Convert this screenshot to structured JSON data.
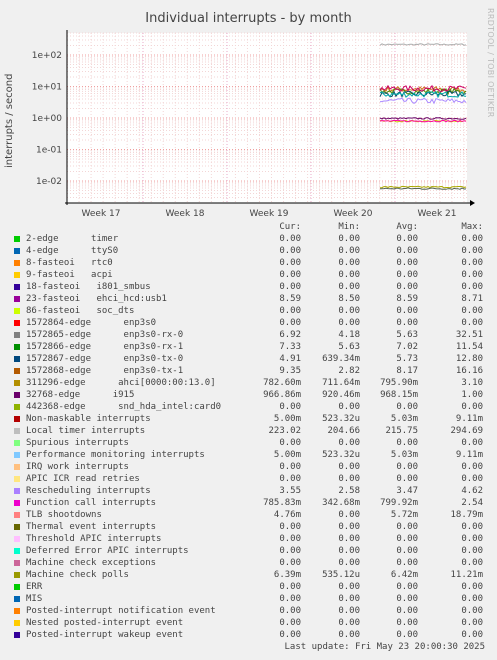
{
  "title": "Individual interrupts - by month",
  "side_text": "RRDTOOL / TOBI OETIKER",
  "chart_data": {
    "type": "line",
    "title": "Individual interrupts - by month",
    "ylabel": "interrupts / second",
    "yscale": "log",
    "ylim": [
      0.002,
      500
    ],
    "yticks": [
      "1e+02",
      "1e+01",
      "1e+00",
      "1e-01",
      "1e-02"
    ],
    "ytick_values": [
      100,
      10,
      1,
      0.1,
      0.01
    ],
    "xticks": [
      "Week 17",
      "Week 18",
      "Week 19",
      "Week 20",
      "Week 21"
    ],
    "grid": true,
    "series_visible_levels": [
      {
        "name": "Local timer interrupts",
        "color": "#aaaaaa",
        "value": 215.75
      },
      {
        "name": "1572868-edge enp3s0-tx-1",
        "color": "#cc7016",
        "value": 8.17
      },
      {
        "name": "1572866-edge enp3s0-rx-1",
        "color": "#4d8a00",
        "value": 7.02
      },
      {
        "name": "1572867-edge enp3s0-tx-0",
        "color": "#004d66",
        "value": 5.73
      },
      {
        "name": "1572865-edge enp3s0-rx-0",
        "color": "#00aaaa",
        "value": 5.63
      },
      {
        "name": "23-fasteoi ehci_hcd:usb1",
        "color": "#cc0066",
        "value": 8.59
      },
      {
        "name": "Rescheduling interrupts",
        "color": "#aa88ff",
        "value": 3.47
      },
      {
        "name": "311296-edge ahci[0000:00:13.0]",
        "color": "#cccc00",
        "value": 0.7959
      },
      {
        "name": "32768-edge i915",
        "color": "#660066",
        "value": 0.96815
      },
      {
        "name": "Function call interrupts",
        "color": "#ff00aa",
        "value": 0.79992
      },
      {
        "name": "Machine check polls",
        "color": "#aaaa00",
        "value": 0.00642
      },
      {
        "name": "Thermal event interrupts",
        "color": "#556655",
        "value": 0.00572
      }
    ]
  },
  "legend": {
    "headers": [
      "Cur:",
      "Min:",
      "Avg:",
      "Max:"
    ],
    "rows": [
      {
        "color": "#00cc00",
        "name": "2-edge      timer",
        "cur": "0.00",
        "min": "0.00",
        "avg": "0.00",
        "max": "0.00"
      },
      {
        "color": "#0066b3",
        "name": "4-edge      ttyS0",
        "cur": "0.00",
        "min": "0.00",
        "avg": "0.00",
        "max": "0.00"
      },
      {
        "color": "#ff8000",
        "name": "8-fasteoi   rtc0",
        "cur": "0.00",
        "min": "0.00",
        "avg": "0.00",
        "max": "0.00"
      },
      {
        "color": "#ffcc00",
        "name": "9-fasteoi   acpi",
        "cur": "0.00",
        "min": "0.00",
        "avg": "0.00",
        "max": "0.00"
      },
      {
        "color": "#330099",
        "name": "18-fasteoi   i801_smbus",
        "cur": "0.00",
        "min": "0.00",
        "avg": "0.00",
        "max": "0.00"
      },
      {
        "color": "#990099",
        "name": "23-fasteoi   ehci_hcd:usb1",
        "cur": "8.59",
        "min": "8.50",
        "avg": "8.59",
        "max": "8.71"
      },
      {
        "color": "#ccff00",
        "name": "86-fasteoi   soc_dts",
        "cur": "0.00",
        "min": "0.00",
        "avg": "0.00",
        "max": "0.00"
      },
      {
        "color": "#ff0000",
        "name": "1572864-edge      enp3s0",
        "cur": "0.00",
        "min": "0.00",
        "avg": "0.00",
        "max": "0.00"
      },
      {
        "color": "#808080",
        "name": "1572865-edge      enp3s0-rx-0",
        "cur": "6.92",
        "min": "4.18",
        "avg": "5.63",
        "max": "32.51"
      },
      {
        "color": "#008f00",
        "name": "1572866-edge      enp3s0-rx-1",
        "cur": "7.33",
        "min": "5.63",
        "avg": "7.02",
        "max": "11.54"
      },
      {
        "color": "#00487d",
        "name": "1572867-edge      enp3s0-tx-0",
        "cur": "4.91",
        "min": "639.34m",
        "avg": "5.73",
        "max": "12.80"
      },
      {
        "color": "#b35a00",
        "name": "1572868-edge      enp3s0-tx-1",
        "cur": "9.35",
        "min": "2.82",
        "avg": "8.17",
        "max": "16.16"
      },
      {
        "color": "#b38f00",
        "name": "311296-edge      ahci[0000:00:13.0]",
        "cur": "782.60m",
        "min": "711.64m",
        "avg": "795.90m",
        "max": "3.10"
      },
      {
        "color": "#6b006b",
        "name": "32768-edge      i915",
        "cur": "966.86m",
        "min": "920.46m",
        "avg": "968.15m",
        "max": "1.00"
      },
      {
        "color": "#8fb300",
        "name": "442368-edge      snd_hda_intel:card0",
        "cur": "0.00",
        "min": "0.00",
        "avg": "0.00",
        "max": "0.00"
      },
      {
        "color": "#b30000",
        "name": "Non-maskable interrupts",
        "cur": "5.00m",
        "min": "523.32u",
        "avg": "5.03m",
        "max": "9.11m"
      },
      {
        "color": "#bebebe",
        "name": "Local timer interrupts",
        "cur": "223.02",
        "min": "204.66",
        "avg": "215.75",
        "max": "294.69"
      },
      {
        "color": "#80ff80",
        "name": "Spurious interrupts",
        "cur": "0.00",
        "min": "0.00",
        "avg": "0.00",
        "max": "0.00"
      },
      {
        "color": "#80c9ff",
        "name": "Performance monitoring interrupts",
        "cur": "5.00m",
        "min": "523.32u",
        "avg": "5.03m",
        "max": "9.11m"
      },
      {
        "color": "#ffc080",
        "name": "IRQ work interrupts",
        "cur": "0.00",
        "min": "0.00",
        "avg": "0.00",
        "max": "0.00"
      },
      {
        "color": "#ffe680",
        "name": "APIC ICR read retries",
        "cur": "0.00",
        "min": "0.00",
        "avg": "0.00",
        "max": "0.00"
      },
      {
        "color": "#aa80ff",
        "name": "Rescheduling interrupts",
        "cur": "3.55",
        "min": "2.58",
        "avg": "3.47",
        "max": "4.62"
      },
      {
        "color": "#ee00cc",
        "name": "Function call interrupts",
        "cur": "785.83m",
        "min": "342.68m",
        "avg": "799.92m",
        "max": "2.54"
      },
      {
        "color": "#ff8080",
        "name": "TLB shootdowns",
        "cur": "4.76m",
        "min": "0.00",
        "avg": "5.72m",
        "max": "18.79m"
      },
      {
        "color": "#666600",
        "name": "Thermal event interrupts",
        "cur": "0.00",
        "min": "0.00",
        "avg": "0.00",
        "max": "0.00"
      },
      {
        "color": "#ffbfff",
        "name": "Threshold APIC interrupts",
        "cur": "0.00",
        "min": "0.00",
        "avg": "0.00",
        "max": "0.00"
      },
      {
        "color": "#00ffcc",
        "name": "Deferred Error APIC interrupts",
        "cur": "0.00",
        "min": "0.00",
        "avg": "0.00",
        "max": "0.00"
      },
      {
        "color": "#cc6699",
        "name": "Machine check exceptions",
        "cur": "0.00",
        "min": "0.00",
        "avg": "0.00",
        "max": "0.00"
      },
      {
        "color": "#999900",
        "name": "Machine check polls",
        "cur": "6.39m",
        "min": "535.12u",
        "avg": "6.42m",
        "max": "11.21m"
      },
      {
        "color": "#00cc00",
        "name": "ERR",
        "cur": "0.00",
        "min": "0.00",
        "avg": "0.00",
        "max": "0.00"
      },
      {
        "color": "#0066b3",
        "name": "MIS",
        "cur": "0.00",
        "min": "0.00",
        "avg": "0.00",
        "max": "0.00"
      },
      {
        "color": "#ff8000",
        "name": "Posted-interrupt notification event",
        "cur": "0.00",
        "min": "0.00",
        "avg": "0.00",
        "max": "0.00"
      },
      {
        "color": "#ffcc00",
        "name": "Nested posted-interrupt event",
        "cur": "0.00",
        "min": "0.00",
        "avg": "0.00",
        "max": "0.00"
      },
      {
        "color": "#330099",
        "name": "Posted-interrupt wakeup event",
        "cur": "0.00",
        "min": "0.00",
        "avg": "0.00",
        "max": "0.00"
      }
    ]
  },
  "last_update": "Last update: Fri May 23 20:00:30 2025"
}
